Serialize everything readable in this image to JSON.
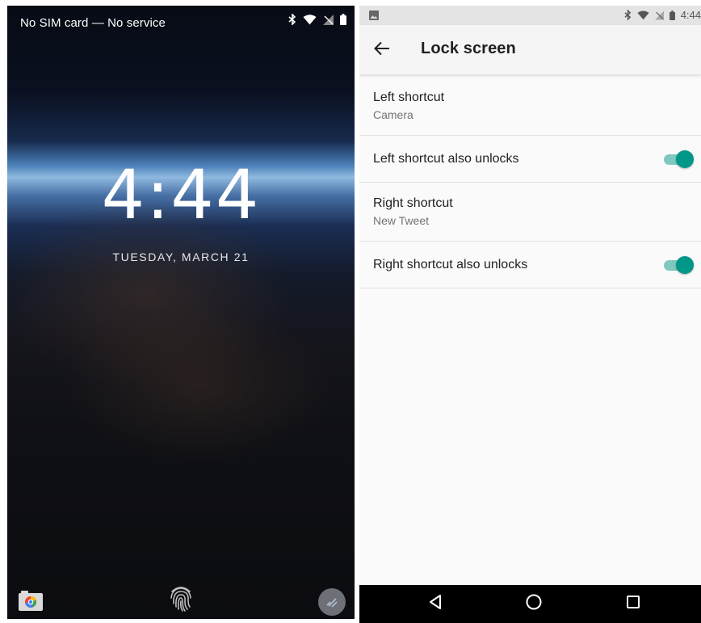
{
  "lockscreen": {
    "status_text": "No SIM card — No service",
    "status_icons": [
      "bluetooth-icon",
      "wifi-icon",
      "no-sim-icon",
      "battery-icon"
    ],
    "clock": "4:44",
    "date": "TUESDAY, MARCH 21",
    "left_shortcut_icon": "camera-icon",
    "center_icon": "fingerprint-icon",
    "right_shortcut_icon": "twitter-icon"
  },
  "settings": {
    "status_time": "4:44",
    "status_left_icon": "image-notification-icon",
    "status_icons": [
      "bluetooth-icon",
      "wifi-icon",
      "no-sim-icon",
      "battery-icon"
    ],
    "title": "Lock screen",
    "back_icon": "back-arrow-icon",
    "items": [
      {
        "title": "Left shortcut",
        "summary": "Camera"
      },
      {
        "title": "Left shortcut also unlocks",
        "toggle": true
      },
      {
        "title": "Right shortcut",
        "summary": "New Tweet"
      },
      {
        "title": "Right shortcut also unlocks",
        "toggle": true
      }
    ],
    "nav_icons": [
      "back-triangle-icon",
      "home-circle-icon",
      "recents-square-icon"
    ]
  },
  "colors": {
    "accent": "#009688",
    "accent_track": "#7fc8c0",
    "navbar": "#000000",
    "statusbar": "#e4e4e4"
  }
}
